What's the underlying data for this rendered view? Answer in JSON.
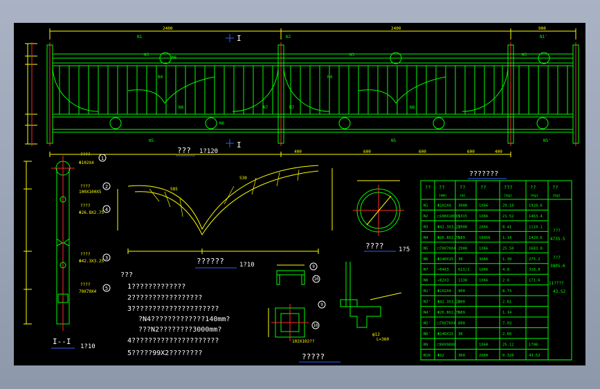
{
  "colors": {
    "line": "#00ff00",
    "dim": "#ffff00",
    "axis": "#ff2a2a",
    "note": "#ffffff",
    "bg": "#000000"
  },
  "elevation": {
    "top_dims": [
      "2400",
      "2400",
      "900"
    ],
    "section_mark": "I",
    "labels": {
      "n1": "N1",
      "n2": "N2",
      "n1p": "N1'",
      "n3": "N3",
      "n3b": "N3",
      "n3c": "N3",
      "n4": "N4",
      "n4b": "N4",
      "n5": "N5",
      "n5b": "N5",
      "n5p": "N5'",
      "n6": "N6",
      "n6b": "N6",
      "n7": "N7",
      "n7b": "N7",
      "n8": "N8",
      "n8b": "N8"
    },
    "bottom_dims": [
      "400",
      "600",
      "600",
      "600",
      "400"
    ],
    "caption": "??? ",
    "scale": "1?120"
  },
  "section": {
    "labels": [
      "????",
      "Φ102X4",
      "????",
      "100X100X5",
      "????",
      "Φ26.8X2.75",
      "????",
      "Φ42.3X3.25",
      "????",
      "70X70X4"
    ],
    "callouts": [
      "1",
      "2",
      "4",
      "3",
      "5"
    ],
    "title": "I--I",
    "scale": "1?10"
  },
  "ornament": {
    "caption": "??????",
    "scale": "1?10",
    "dims": [
      "585",
      "530"
    ]
  },
  "pipe": {
    "caption": "????",
    "scale": "1?5"
  },
  "notes": {
    "title": "???",
    "lines": [
      "1?????????????",
      "2?????????????????",
      "3?????????????????????",
      "?N4?????????????140mm?",
      "???N2????????3000mm?",
      "4?????????????????????",
      "5?????99X2????????"
    ]
  },
  "details": {
    "callouts": [
      "9",
      "10",
      "9",
      "10"
    ],
    "caption": "?????",
    "note": "102X102??",
    "rebar": [
      "φ12",
      "L=360"
    ]
  },
  "table": {
    "title": "???????",
    "headers": [
      "??",
      "??",
      "??",
      "??",
      "???",
      "??",
      "??"
    ],
    "subheaders": [
      "",
      "(mm)",
      "(m)",
      "",
      "(kg)",
      "(kg)",
      "(kg)"
    ],
    "rows": [
      [
        "N1",
        "Φ102X4",
        "3000",
        "1X66",
        "29.10",
        "1920.6",
        ""
      ],
      [
        "N2",
        "□100X100X5",
        "1315",
        "1X66",
        "21.52",
        "1463.4",
        ""
      ],
      [
        "N3",
        "Φ42.3X3.25",
        "2900",
        "2X66",
        "8.41",
        "1110.1",
        ""
      ],
      [
        "N4",
        "Φ26.8X2.75",
        "689",
        "19X66",
        "1.14",
        "1429.6",
        ""
      ],
      [
        "N5",
        "□70X70X4",
        "2900",
        "1X66",
        "25.50",
        "1683.0",
        ""
      ],
      [
        "N6",
        "Φ140X15",
        "30",
        "3X66",
        "1.39",
        "275.2",
        ""
      ],
      [
        "N7",
        "∠64X3",
        "621/2",
        "1X66",
        "4.8",
        "316.8",
        ""
      ],
      [
        "N8",
        "∠82X3",
        "1338",
        "1X66",
        "2.6",
        "171.6",
        ""
      ],
      [
        "N1'",
        "Φ102X4",
        "900",
        "",
        "8.73",
        "",
        ""
      ],
      [
        "N3'",
        "Φ42.3X3.25",
        "800",
        "",
        "2.61",
        "",
        ""
      ],
      [
        "N4'",
        "Φ26.8X2.75",
        "689",
        "",
        "1.14",
        "",
        ""
      ],
      [
        "N5'",
        "□70X70X4",
        "800",
        "",
        "7.03",
        "",
        ""
      ],
      [
        "N6'",
        "Φ140X15",
        "30",
        "",
        "2.60",
        "",
        ""
      ],
      [
        "N9",
        "□90X90X8",
        "",
        "1X60",
        "25.12",
        "1708",
        ""
      ],
      [
        "N10",
        "Φ12",
        "360",
        "2X60",
        "0.320",
        "43.52",
        ""
      ]
    ],
    "side": [
      "???",
      "4735.5",
      "???",
      "3805.6",
      "11????",
      "43.52"
    ]
  }
}
